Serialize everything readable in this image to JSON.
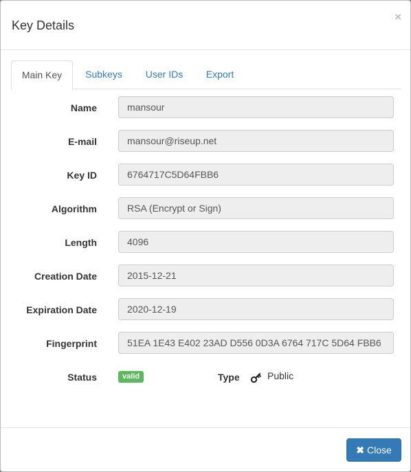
{
  "dialog": {
    "title": "Key Details",
    "close_glyph": "×"
  },
  "tabs": [
    {
      "label": "Main Key",
      "active": true
    },
    {
      "label": "Subkeys",
      "active": false
    },
    {
      "label": "User IDs",
      "active": false
    },
    {
      "label": "Export",
      "active": false
    }
  ],
  "fields": [
    {
      "label": "Name",
      "value": "mansour"
    },
    {
      "label": "E-mail",
      "value": "mansour@riseup.net"
    },
    {
      "label": "Key ID",
      "value": "6764717C5D64FBB6"
    },
    {
      "label": "Algorithm",
      "value": "RSA (Encrypt or Sign)"
    },
    {
      "label": "Length",
      "value": "4096"
    },
    {
      "label": "Creation Date",
      "value": "2015-12-21"
    },
    {
      "label": "Expiration Date",
      "value": "2020-12-19"
    },
    {
      "label": "Fingerprint",
      "value": "51EA 1E43 E402 23AD D556 0D3A 6764 717C 5D64 FBB6"
    }
  ],
  "status": {
    "label": "Status",
    "badge": "valid",
    "badge_color": "#5cb85c"
  },
  "type": {
    "label": "Type",
    "icon": "key-icon",
    "value": "Public"
  },
  "footer": {
    "close_icon": "close-x-icon",
    "close_glyph": "✖",
    "close_label": "Close",
    "button_color": "#337ab7"
  }
}
